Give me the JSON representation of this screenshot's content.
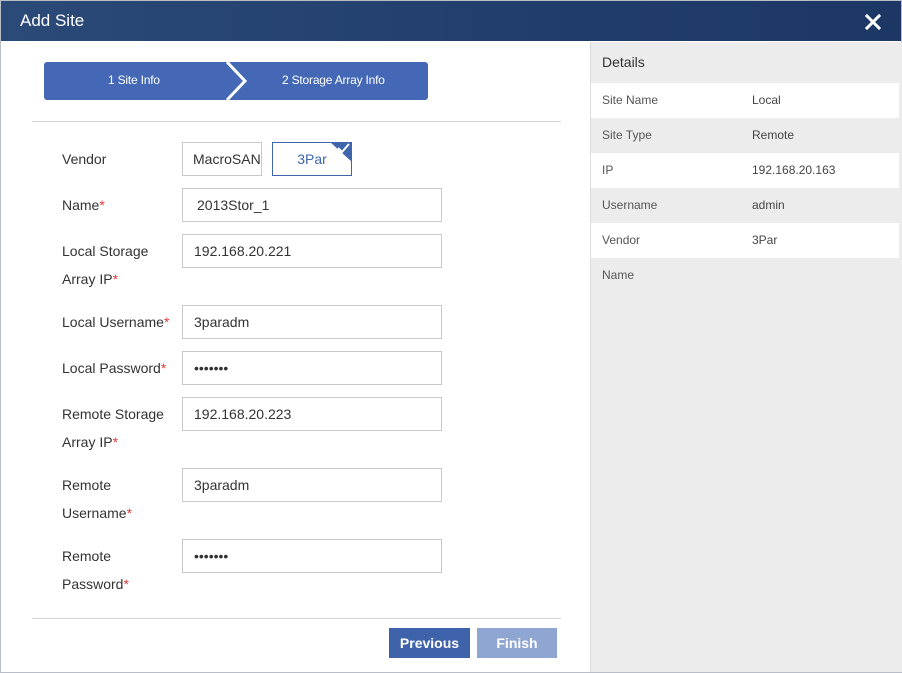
{
  "dialog": {
    "title": "Add Site",
    "close_icon": "close-icon"
  },
  "steps": [
    {
      "label": "1 Site Info"
    },
    {
      "label": "2 Storage Array Info"
    }
  ],
  "form": {
    "vendor": {
      "label": "Vendor",
      "options": [
        "MacroSAN",
        "3Par"
      ],
      "selected": "3Par"
    },
    "name": {
      "label": "Name",
      "value": "2013Stor_1"
    },
    "local_ip": {
      "label_line1": "Local Storage",
      "label_line2": "Array IP",
      "value": "192.168.20.221"
    },
    "local_username": {
      "label": "Local Username",
      "value": "3paradm"
    },
    "local_password": {
      "label": "Local Password",
      "value": "•••••••"
    },
    "remote_ip": {
      "label_line1": "Remote Storage",
      "label_line2": "Array IP",
      "value": "192.168.20.223"
    },
    "remote_username": {
      "label_line1": "Remote",
      "label_line2": "Username",
      "value": "3paradm"
    },
    "remote_password": {
      "label_line1": "Remote",
      "label_line2": "Password",
      "value": "•••••••"
    },
    "required_mark": "*"
  },
  "buttons": {
    "previous": "Previous",
    "finish": "Finish"
  },
  "details": {
    "title": "Details",
    "rows": [
      {
        "key": "Site Name",
        "value": "Local"
      },
      {
        "key": "Site Type",
        "value": "Remote"
      },
      {
        "key": "IP",
        "value": "192.168.20.163"
      },
      {
        "key": "Username",
        "value": "admin"
      },
      {
        "key": "Vendor",
        "value": "3Par"
      },
      {
        "key": "Name",
        "value": ""
      }
    ]
  },
  "colors": {
    "titlebar": "#213d6b",
    "primary": "#3f63ab",
    "disabled": "#8fa6d3",
    "required": "#e23b3b"
  }
}
